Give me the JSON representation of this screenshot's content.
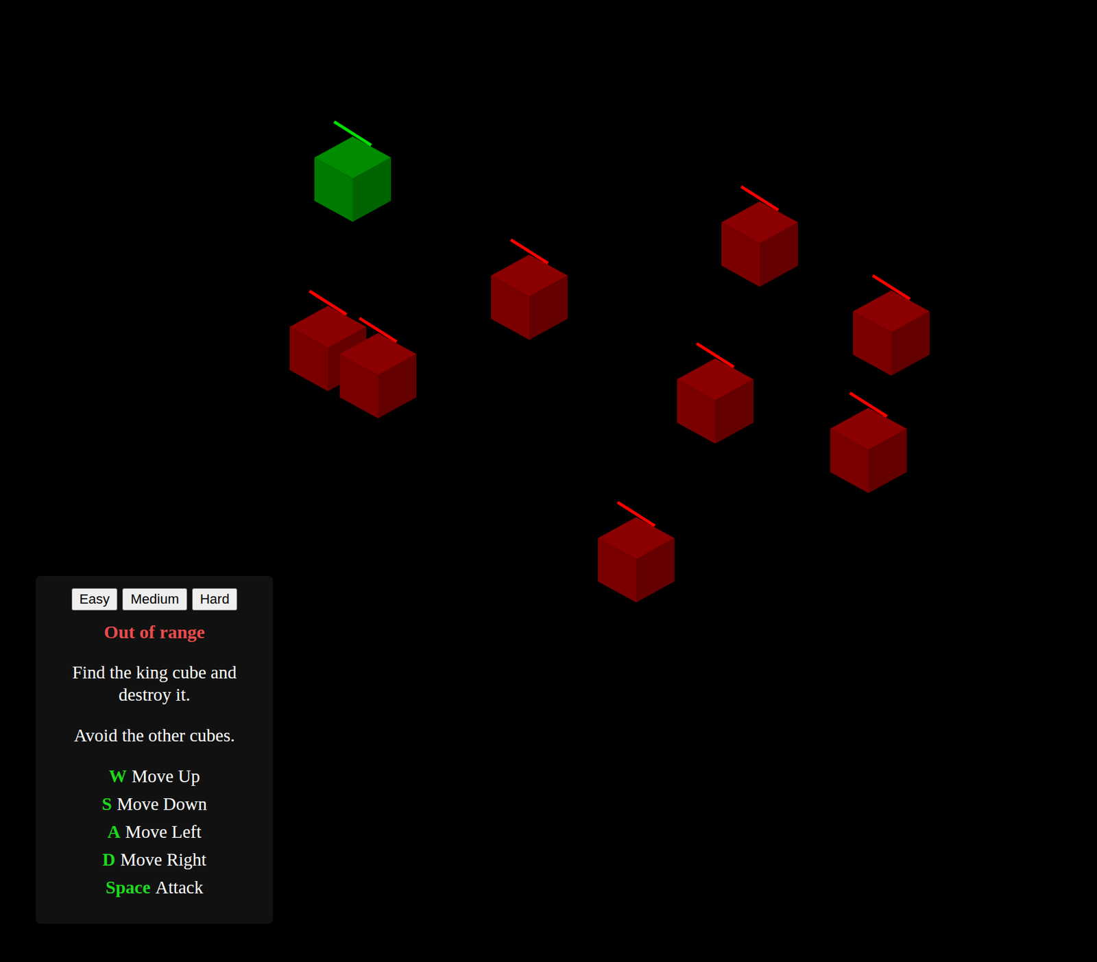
{
  "difficulty_buttons": [
    {
      "label": "Easy"
    },
    {
      "label": "Medium"
    },
    {
      "label": "Hard"
    }
  ],
  "status": "Out of range",
  "instructions": [
    "Find the king cube and destroy it.",
    "Avoid the other cubes."
  ],
  "controls": [
    {
      "key": "W",
      "action": "Move Up"
    },
    {
      "key": "S",
      "action": "Move Down"
    },
    {
      "key": "A",
      "action": "Move Left"
    },
    {
      "key": "D",
      "action": "Move Right"
    },
    {
      "key": "Space",
      "action": "Attack"
    }
  ],
  "cubes": [
    {
      "kind": "player",
      "color": "#008b00"
    },
    {
      "kind": "enemy",
      "color": "#8b0000"
    },
    {
      "kind": "enemy",
      "color": "#8b0000"
    },
    {
      "kind": "enemy",
      "color": "#8b0000"
    },
    {
      "kind": "enemy",
      "color": "#8b0000"
    },
    {
      "kind": "enemy",
      "color": "#8b0000"
    },
    {
      "kind": "enemy",
      "color": "#8b0000"
    },
    {
      "kind": "enemy",
      "color": "#8b0000"
    },
    {
      "kind": "enemy",
      "color": "#8b0000"
    }
  ]
}
